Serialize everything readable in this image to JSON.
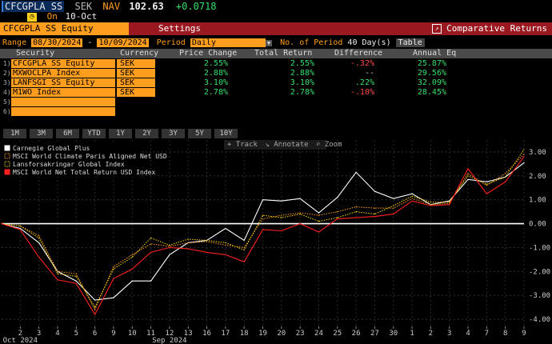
{
  "header": {
    "ticker": "CFCGPLA SS",
    "currency": "SEK",
    "nav_label": "NAV",
    "nav_value": "102.63",
    "nav_change": "+0.0718",
    "on_label": "On",
    "on_date": "10-Oct"
  },
  "toolbar": {
    "security": "CFCGPLA SS Equity",
    "settings": "Settings",
    "comparative": "Comparative Returns"
  },
  "range": {
    "label": "Range",
    "start": "08/30/2024",
    "sep": "-",
    "end": "10/09/2024",
    "period_label": "Period",
    "period": "Daily",
    "num_label": "No. of Period",
    "num_value": "40 Day(s)",
    "table_btn": "Table"
  },
  "table": {
    "headers": [
      "Security",
      "Currency",
      "Price Change",
      "Total Return",
      "Difference",
      "Annual Eq"
    ],
    "rows": [
      {
        "n": "1)",
        "security": "CFCGPLA SS Equity",
        "currency": "SEK",
        "price": "2.55%",
        "total": "2.55%",
        "diff": "-.32%",
        "annual": "25.87%"
      },
      {
        "n": "2)",
        "security": "MXWOCLPA Index",
        "currency": "SEK",
        "price": "2.88%",
        "total": "2.88%",
        "diff": "--",
        "annual": "29.56%"
      },
      {
        "n": "3)",
        "security": "LANFSGI SS Equity",
        "currency": "SEK",
        "price": "3.10%",
        "total": "3.10%",
        "diff": ".22%",
        "annual": "32.09%"
      },
      {
        "n": "4)",
        "security": "M1WO Index",
        "currency": "SEK",
        "price": "2.78%",
        "total": "2.78%",
        "diff": "-.10%",
        "annual": "28.45%"
      }
    ],
    "empty_rows": [
      "5)",
      "6)"
    ]
  },
  "periods": [
    "1M",
    "3M",
    "6M",
    "YTD",
    "1Y",
    "2Y",
    "3Y",
    "5Y",
    "10Y"
  ],
  "chart_tools": {
    "track": "Track",
    "annotate": "Annotate",
    "zoom": "Zoom"
  },
  "colors": {
    "orange": "#ff9d1e",
    "red_bar": "#9a1820",
    "green": "#35e06a",
    "red": "#ff4a4a"
  },
  "chart_data": {
    "type": "line",
    "legend_placement": "top-left",
    "x": [
      "30",
      "2",
      "3",
      "4",
      "5",
      "6",
      "9",
      "10",
      "11",
      "12",
      "13",
      "16",
      "17",
      "18",
      "19",
      "20",
      "23",
      "24",
      "25",
      "26",
      "27",
      "30",
      "1",
      "2",
      "3",
      "4",
      "7",
      "8",
      "9"
    ],
    "xtick_labels": [
      "2",
      "3",
      "4",
      "5",
      "6",
      "9",
      "10",
      "11",
      "12",
      "13",
      "16",
      "17",
      "18",
      "19",
      "20",
      "23",
      "24",
      "25",
      "26",
      "27",
      "30",
      "1",
      "2",
      "3",
      "4",
      "7",
      "8",
      "9"
    ],
    "month_labels": [
      {
        "label": "Sep 2024",
        "at": "12"
      },
      {
        "label": "Oct 2024",
        "at": "2"
      }
    ],
    "ylim": [
      -4.3,
      3.5
    ],
    "yticks": [
      3,
      2,
      1,
      0,
      -1,
      -2,
      -3,
      -4
    ],
    "ytick_labels": [
      "3.00",
      "2.00",
      "1.00",
      "0.00",
      "-1.00",
      "-2.00",
      "-3.00",
      "-4.00"
    ],
    "series": [
      {
        "name": "Carnegie Global Plus",
        "color": "#ffffff",
        "style": "solid",
        "values": [
          0,
          -0.2,
          -0.8,
          -2.0,
          -2.4,
          -3.2,
          -3.1,
          -2.4,
          -2.4,
          -1.3,
          -0.8,
          -0.7,
          -0.2,
          -0.7,
          1.0,
          0.95,
          1.05,
          0.45,
          1.1,
          2.15,
          1.35,
          1.05,
          1.25,
          0.8,
          0.95,
          1.85,
          1.75,
          1.95,
          2.55
        ]
      },
      {
        "name": "MSCI World Climate Paris Aligned Net USD",
        "color": "#ff9d1e",
        "style": "dotted",
        "values": [
          0,
          -0.1,
          -0.5,
          -2.0,
          -2.1,
          -3.6,
          -1.8,
          -1.3,
          -0.85,
          -0.95,
          -0.8,
          -0.75,
          -0.9,
          -1.0,
          0.2,
          0.35,
          0.45,
          0.35,
          0.5,
          0.7,
          0.65,
          0.65,
          1.05,
          0.8,
          0.85,
          2.1,
          1.6,
          2.1,
          2.9
        ]
      },
      {
        "name": "Lansforsakringar Global Index",
        "color": "#ffd700",
        "style": "dotted",
        "values": [
          0,
          -0.1,
          -0.6,
          -2.1,
          -2.2,
          -3.5,
          -1.9,
          -1.4,
          -0.6,
          -0.9,
          -0.65,
          -0.7,
          -0.8,
          -1.1,
          0.35,
          0.25,
          0.4,
          0.1,
          0.25,
          0.5,
          0.4,
          0.75,
          1.15,
          0.9,
          0.9,
          2.0,
          1.65,
          1.95,
          3.1
        ]
      },
      {
        "name": "MSCI World Net Total Return USD Index",
        "color": "#ff2020",
        "style": "solid",
        "values": [
          0,
          -0.25,
          -1.4,
          -2.35,
          -2.5,
          -3.8,
          -2.3,
          -1.9,
          -1.2,
          -1.0,
          -1.05,
          -1.2,
          -1.3,
          -1.6,
          -0.25,
          -0.3,
          0.0,
          -0.35,
          0.2,
          0.25,
          0.3,
          0.4,
          0.95,
          0.75,
          0.8,
          2.3,
          1.25,
          1.75,
          2.8
        ]
      }
    ]
  }
}
